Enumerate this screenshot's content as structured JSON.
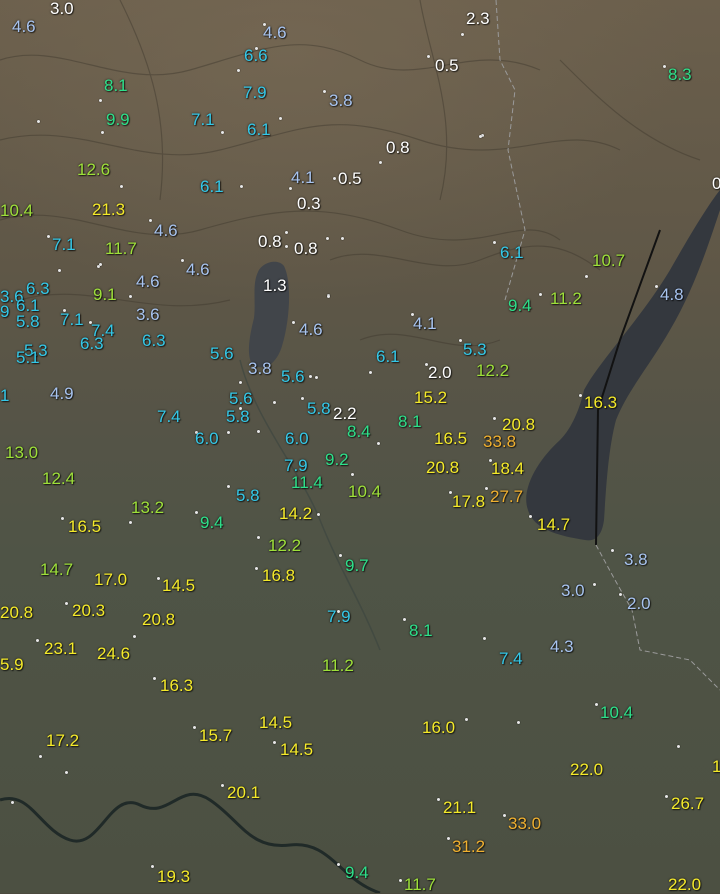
{
  "legend_colors": {
    "white": "#ffffff",
    "light_blue": "#a8c4f0",
    "cyan": "#34c8e8",
    "teal_green": "#2ee08a",
    "yellow_green": "#9ee03a",
    "yellow": "#f5ea2a",
    "orange": "#f0b030"
  },
  "stations": [
    {
      "v": "3.0",
      "c": "#ffffff"
    },
    {
      "v": "4.6",
      "c": "#a8c4f0"
    },
    {
      "v": "4.6",
      "c": "#a8c4f0"
    },
    {
      "v": "6.6",
      "c": "#34c8e8"
    },
    {
      "v": "2.3",
      "c": "#ffffff"
    },
    {
      "v": "0.5",
      "c": "#ffffff"
    },
    {
      "v": "8.3",
      "c": "#2ee08a"
    },
    {
      "v": "8.1",
      "c": "#2ee08a"
    },
    {
      "v": "7.9",
      "c": "#34c8e8"
    },
    {
      "v": "3.8",
      "c": "#a8c4f0"
    },
    {
      "v": "9.9",
      "c": "#2ee08a"
    },
    {
      "v": "7.1",
      "c": "#34c8e8"
    },
    {
      "v": "6.1",
      "c": "#34c8e8"
    },
    {
      "v": "0.8",
      "c": "#ffffff"
    },
    {
      "v": "12.6",
      "c": "#9ee03a"
    },
    {
      "v": "6.1",
      "c": "#34c8e8"
    },
    {
      "v": "4.1",
      "c": "#a8c4f0"
    },
    {
      "v": "0.5",
      "c": "#ffffff"
    },
    {
      "v": "0",
      "c": "#ffffff"
    },
    {
      "v": "10.4",
      "c": "#9ee03a"
    },
    {
      "v": "21.3",
      "c": "#f5ea2a"
    },
    {
      "v": "0.3",
      "c": "#ffffff"
    },
    {
      "v": "4.6",
      "c": "#a8c4f0"
    },
    {
      "v": "7.1",
      "c": "#34c8e8"
    },
    {
      "v": "11.7",
      "c": "#9ee03a"
    },
    {
      "v": "0.8",
      "c": "#ffffff"
    },
    {
      "v": "0.8",
      "c": "#ffffff"
    },
    {
      "v": "6.1",
      "c": "#34c8e8"
    },
    {
      "v": "10.7",
      "c": "#9ee03a"
    },
    {
      "v": "4.6",
      "c": "#a8c4f0"
    },
    {
      "v": "1.3",
      "c": "#ffffff"
    },
    {
      "v": "4.6",
      "c": "#a8c4f0"
    },
    {
      "v": "6.3",
      "c": "#34c8e8"
    },
    {
      "v": "9.1",
      "c": "#9ee03a"
    },
    {
      "v": "4.8",
      "c": "#a8c4f0"
    },
    {
      "v": "3.6",
      "c": "#34c8e8"
    },
    {
      "v": "6.1",
      "c": "#34c8e8"
    },
    {
      "v": "9.4",
      "c": "#2ee08a"
    },
    {
      "v": "11.2",
      "c": "#9ee03a"
    },
    {
      "v": "9",
      "c": "#34c8e8"
    },
    {
      "v": "5.8",
      "c": "#34c8e8"
    },
    {
      "v": "7.1",
      "c": "#34c8e8"
    },
    {
      "v": "3.6",
      "c": "#a8c4f0"
    },
    {
      "v": "4.1",
      "c": "#a8c4f0"
    },
    {
      "v": "7.4",
      "c": "#34c8e8"
    },
    {
      "v": "4.6",
      "c": "#a8c4f0"
    },
    {
      "v": "6.3",
      "c": "#34c8e8"
    },
    {
      "v": "6.3",
      "c": "#34c8e8"
    },
    {
      "v": "5.3",
      "c": "#34c8e8"
    },
    {
      "v": "5.3",
      "c": "#34c8e8"
    },
    {
      "v": "5.1",
      "c": "#34c8e8"
    },
    {
      "v": "5.6",
      "c": "#34c8e8"
    },
    {
      "v": "6.1",
      "c": "#34c8e8"
    },
    {
      "v": "3.8",
      "c": "#a8c4f0"
    },
    {
      "v": "2.0",
      "c": "#ffffff"
    },
    {
      "v": "12.2",
      "c": "#9ee03a"
    },
    {
      "v": "5.6",
      "c": "#34c8e8"
    },
    {
      "v": "1",
      "c": "#34c8e8"
    },
    {
      "v": "4.9",
      "c": "#a8c4f0"
    },
    {
      "v": "5.6",
      "c": "#34c8e8"
    },
    {
      "v": "15.2",
      "c": "#f5ea2a"
    },
    {
      "v": "16.3",
      "c": "#f5ea2a"
    },
    {
      "v": "5.8",
      "c": "#34c8e8"
    },
    {
      "v": "2.2",
      "c": "#ffffff"
    },
    {
      "v": "7.4",
      "c": "#34c8e8"
    },
    {
      "v": "5.8",
      "c": "#34c8e8"
    },
    {
      "v": "8.1",
      "c": "#2ee08a"
    },
    {
      "v": "20.8",
      "c": "#f5ea2a"
    },
    {
      "v": "8.4",
      "c": "#2ee08a"
    },
    {
      "v": "6.0",
      "c": "#34c8e8"
    },
    {
      "v": "6.0",
      "c": "#34c8e8"
    },
    {
      "v": "16.5",
      "c": "#f5ea2a"
    },
    {
      "v": "33.8",
      "c": "#f0b030"
    },
    {
      "v": "13.0",
      "c": "#9ee03a"
    },
    {
      "v": "9.2",
      "c": "#2ee08a"
    },
    {
      "v": "7.9",
      "c": "#34c8e8"
    },
    {
      "v": "20.8",
      "c": "#f5ea2a"
    },
    {
      "v": "18.4",
      "c": "#f5ea2a"
    },
    {
      "v": "12.4",
      "c": "#9ee03a"
    },
    {
      "v": "11.4",
      "c": "#2ee08a"
    },
    {
      "v": "10.4",
      "c": "#9ee03a"
    },
    {
      "v": "5.8",
      "c": "#34c8e8"
    },
    {
      "v": "17.8",
      "c": "#f5ea2a"
    },
    {
      "v": "27.7",
      "c": "#f0b030"
    },
    {
      "v": "13.2",
      "c": "#9ee03a"
    },
    {
      "v": "14.2",
      "c": "#f5ea2a"
    },
    {
      "v": "16.5",
      "c": "#f5ea2a"
    },
    {
      "v": "9.4",
      "c": "#2ee08a"
    },
    {
      "v": "14.7",
      "c": "#f5ea2a"
    },
    {
      "v": "12.2",
      "c": "#9ee03a"
    },
    {
      "v": "3.8",
      "c": "#a8c4f0"
    },
    {
      "v": "9.7",
      "c": "#2ee08a"
    },
    {
      "v": "14.7",
      "c": "#9ee03a"
    },
    {
      "v": "16.8",
      "c": "#f5ea2a"
    },
    {
      "v": "17.0",
      "c": "#f5ea2a"
    },
    {
      "v": "14.5",
      "c": "#f5ea2a"
    },
    {
      "v": "3.0",
      "c": "#a8c4f0"
    },
    {
      "v": "2.0",
      "c": "#a8c4f0"
    },
    {
      "v": "20.8",
      "c": "#f5ea2a"
    },
    {
      "v": "20.3",
      "c": "#f5ea2a"
    },
    {
      "v": "20.8",
      "c": "#f5ea2a"
    },
    {
      "v": "7.9",
      "c": "#34c8e8"
    },
    {
      "v": "8.1",
      "c": "#2ee08a"
    },
    {
      "v": "23.1",
      "c": "#f5ea2a"
    },
    {
      "v": "24.6",
      "c": "#f5ea2a"
    },
    {
      "v": "4.3",
      "c": "#a8c4f0"
    },
    {
      "v": "7.4",
      "c": "#34c8e8"
    },
    {
      "v": "5.9",
      "c": "#f5ea2a"
    },
    {
      "v": "11.2",
      "c": "#9ee03a"
    },
    {
      "v": "16.3",
      "c": "#f5ea2a"
    },
    {
      "v": "10.4",
      "c": "#2ee08a"
    },
    {
      "v": "14.5",
      "c": "#f5ea2a"
    },
    {
      "v": "16.0",
      "c": "#f5ea2a"
    },
    {
      "v": "15.7",
      "c": "#f5ea2a"
    },
    {
      "v": "17.2",
      "c": "#f5ea2a"
    },
    {
      "v": "14.5",
      "c": "#f5ea2a"
    },
    {
      "v": "22.0",
      "c": "#f5ea2a"
    },
    {
      "v": "1",
      "c": "#f5ea2a"
    },
    {
      "v": "20.1",
      "c": "#f5ea2a"
    },
    {
      "v": "26.7",
      "c": "#f5ea2a"
    },
    {
      "v": "21.1",
      "c": "#f5ea2a"
    },
    {
      "v": "33.0",
      "c": "#f0b030"
    },
    {
      "v": "31.2",
      "c": "#f0b030"
    },
    {
      "v": "19.3",
      "c": "#f5ea2a"
    },
    {
      "v": "9.4",
      "c": "#2ee08a"
    },
    {
      "v": "11.7",
      "c": "#9ee03a"
    },
    {
      "v": "22.0",
      "c": "#f5ea2a"
    }
  ]
}
